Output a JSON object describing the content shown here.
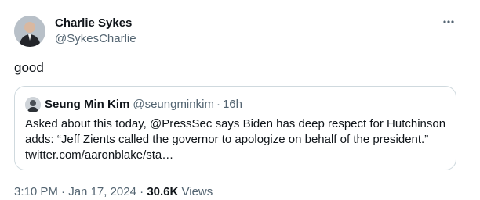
{
  "author": {
    "name": "Charlie Sykes",
    "handle": "@SykesCharlie"
  },
  "more_icon": "more-horizontal-icon",
  "tweet": {
    "text": "good"
  },
  "quoted": {
    "name": "Seung Min Kim",
    "handle": "@seungminkim",
    "separator": "·",
    "time": "16h",
    "text": "Asked about this today, @PressSec says Biden has deep respect for Hutchinson adds: “Jeff Zients called the governor to apologize on behalf of the president.” twitter.com/aaronblake/sta…"
  },
  "meta": {
    "time": "3:10 PM",
    "dot1": "·",
    "date": "Jan 17, 2024",
    "dot2": "·",
    "views_count": "30.6K",
    "views_label": "Views"
  },
  "colors": {
    "text": "#0f1419",
    "secondary": "#536471",
    "border": "#cfd9de"
  }
}
